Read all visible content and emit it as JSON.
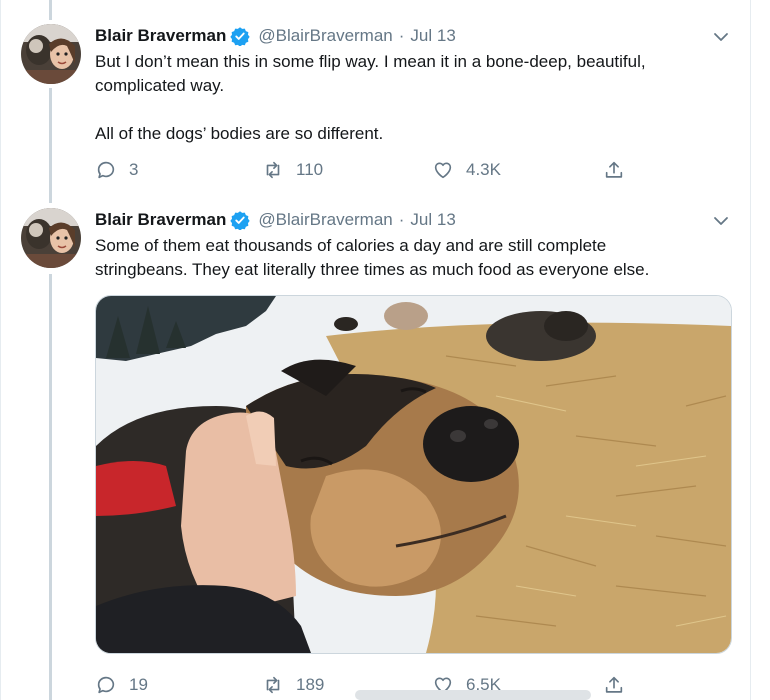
{
  "tweets": [
    {
      "author_name": "Blair Braverman",
      "handle": "@BlairBraverman",
      "separator": "·",
      "date": "Jul 13",
      "text_lines": [
        "But I don’t mean this in some flip way. I mean it in a bone-deep, beautiful,",
        "complicated way.",
        "",
        "All of the dogs’ bodies are so different."
      ],
      "replies": "3",
      "retweets": "110",
      "likes": "4.3K"
    },
    {
      "author_name": "Blair Braverman",
      "handle": "@BlairBraverman",
      "separator": "·",
      "date": "Jul 13",
      "text_lines": [
        "Some of them eat thousands of calories a day and are still complete",
        "stringbeans. They eat literally three times as much food as everyone else."
      ],
      "replies": "19",
      "retweets": "189",
      "likes": "6.5K"
    }
  ],
  "colors": {
    "text": "#14171a",
    "muted": "#657786",
    "verified": "#1da1f2",
    "thread_line": "#ccd6dd",
    "border": "#e6ecf0"
  },
  "icons": [
    "verified-icon",
    "chevron-down-icon",
    "reply-icon",
    "retweet-icon",
    "like-icon",
    "share-icon"
  ]
}
